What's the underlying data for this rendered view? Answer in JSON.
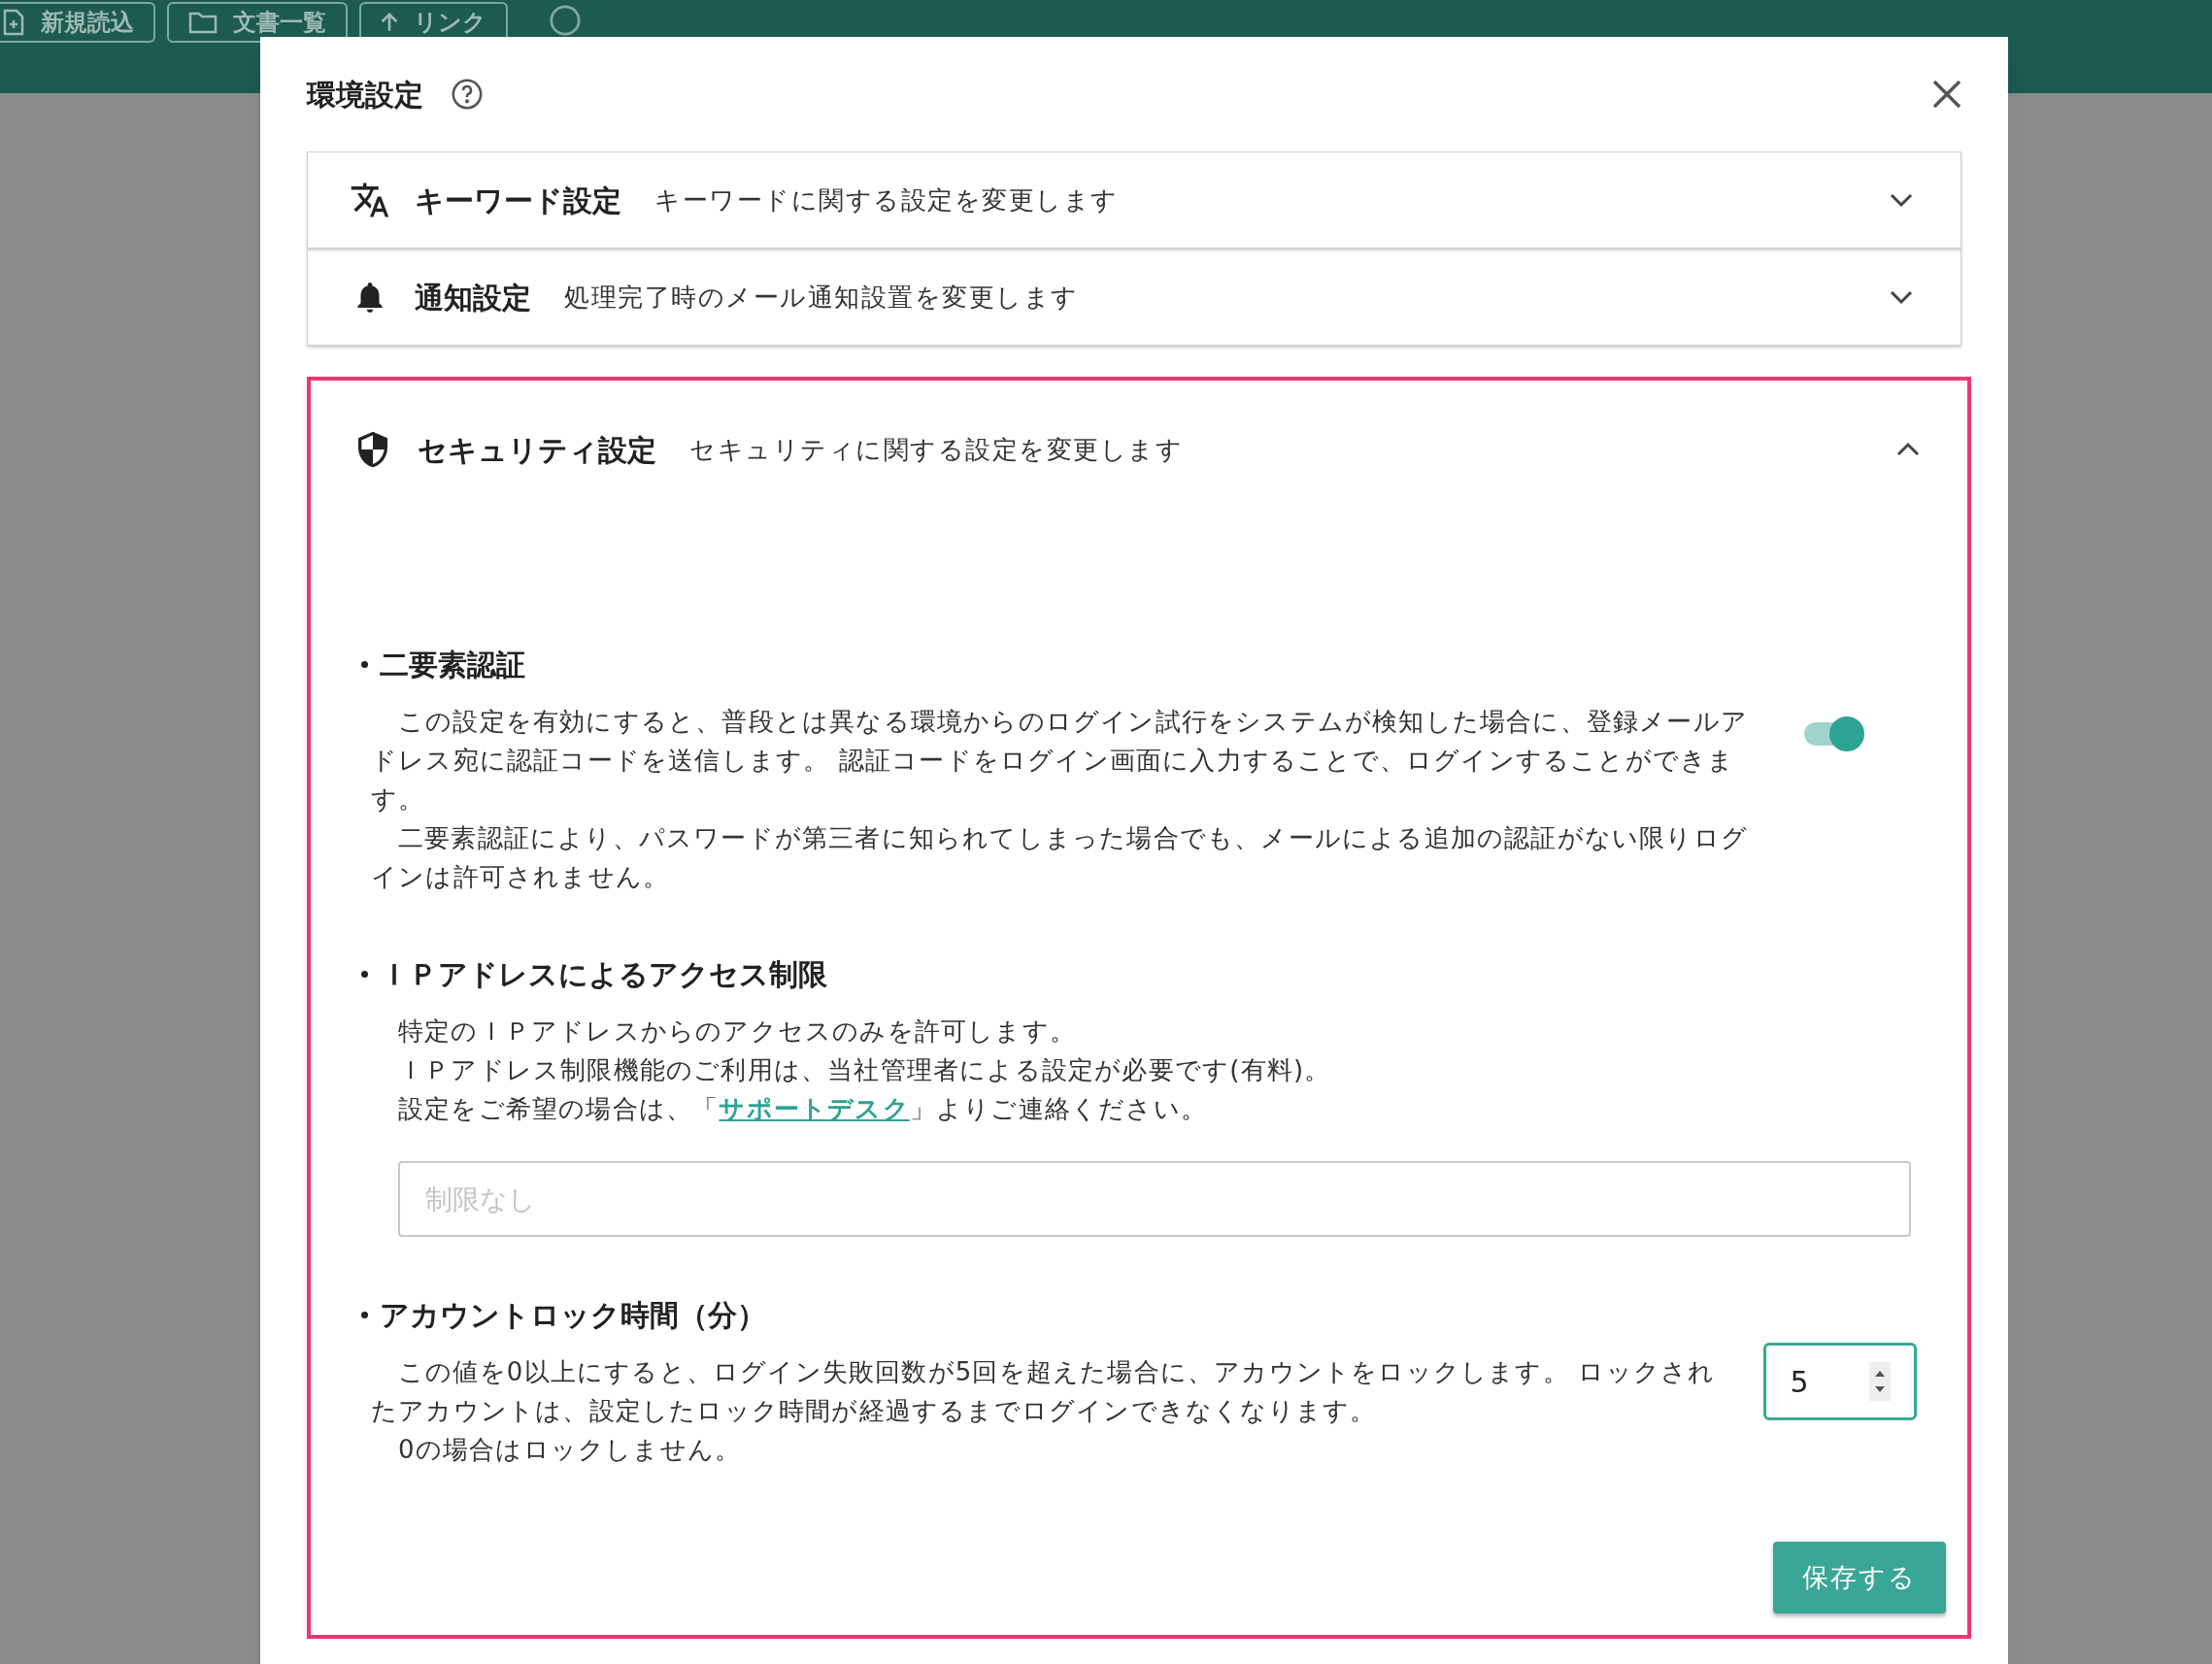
{
  "toolbar": {
    "buttons": [
      {
        "kind": "new",
        "label": "新規読込"
      },
      {
        "kind": "folder",
        "label": "文書一覧"
      },
      {
        "kind": "link",
        "label": "リンク"
      }
    ]
  },
  "dialog": {
    "title": "環境設定",
    "sections": [
      {
        "kind": "keyword",
        "title": "キーワード設定",
        "description": "キーワードに関する設定を変更します",
        "expanded": false
      },
      {
        "kind": "notification",
        "title": "通知設定",
        "description": "処理完了時のメール通知設置を変更します",
        "expanded": false
      },
      {
        "kind": "security",
        "title": "セキュリティ設定",
        "description": "セキュリティに関する設定を変更します",
        "expanded": true
      }
    ],
    "security": {
      "items": [
        {
          "kind": "toggle",
          "title": "二要素認証",
          "paragraphs": [
            "この設定を有効にすると、普段とは異なる環境からのログイン試行をシステムが検知した場合に、登録メールアドレス宛に認証コードを送信します。 認証コードをログイン画面に入力することで、ログインすることができます。",
            "二要素認証により、パスワードが第三者に知られてしまった場合でも、メールによる追加の認証がない限りログインは許可されません。"
          ],
          "on": true
        },
        {
          "kind": "ip",
          "title": "ＩＰアドレスによるアクセス制限",
          "paragraphs": [
            "特定のＩＰアドレスからのアクセスのみを許可します。",
            "ＩＰアドレス制限機能のご利用は、当社管理者による設定が必要です(有料)。"
          ],
          "link_sentence": {
            "before": "設定をご希望の場合は、「",
            "link": "サポートデスク",
            "after": "」よりご連絡ください。"
          },
          "placeholder": "制限なし"
        },
        {
          "kind": "number",
          "title": "アカウントロック時間（分）",
          "paragraphs": [
            "この値を0以上にすると、ログイン失敗回数が5回を超えた場合に、アカウントをロックします。 ロックされたアカウントは、設定したロック時間が経過するまでログインできなくなります。",
            "0の場合はロックしません。"
          ],
          "value": "5"
        }
      ],
      "save_button": "保存する"
    }
  }
}
